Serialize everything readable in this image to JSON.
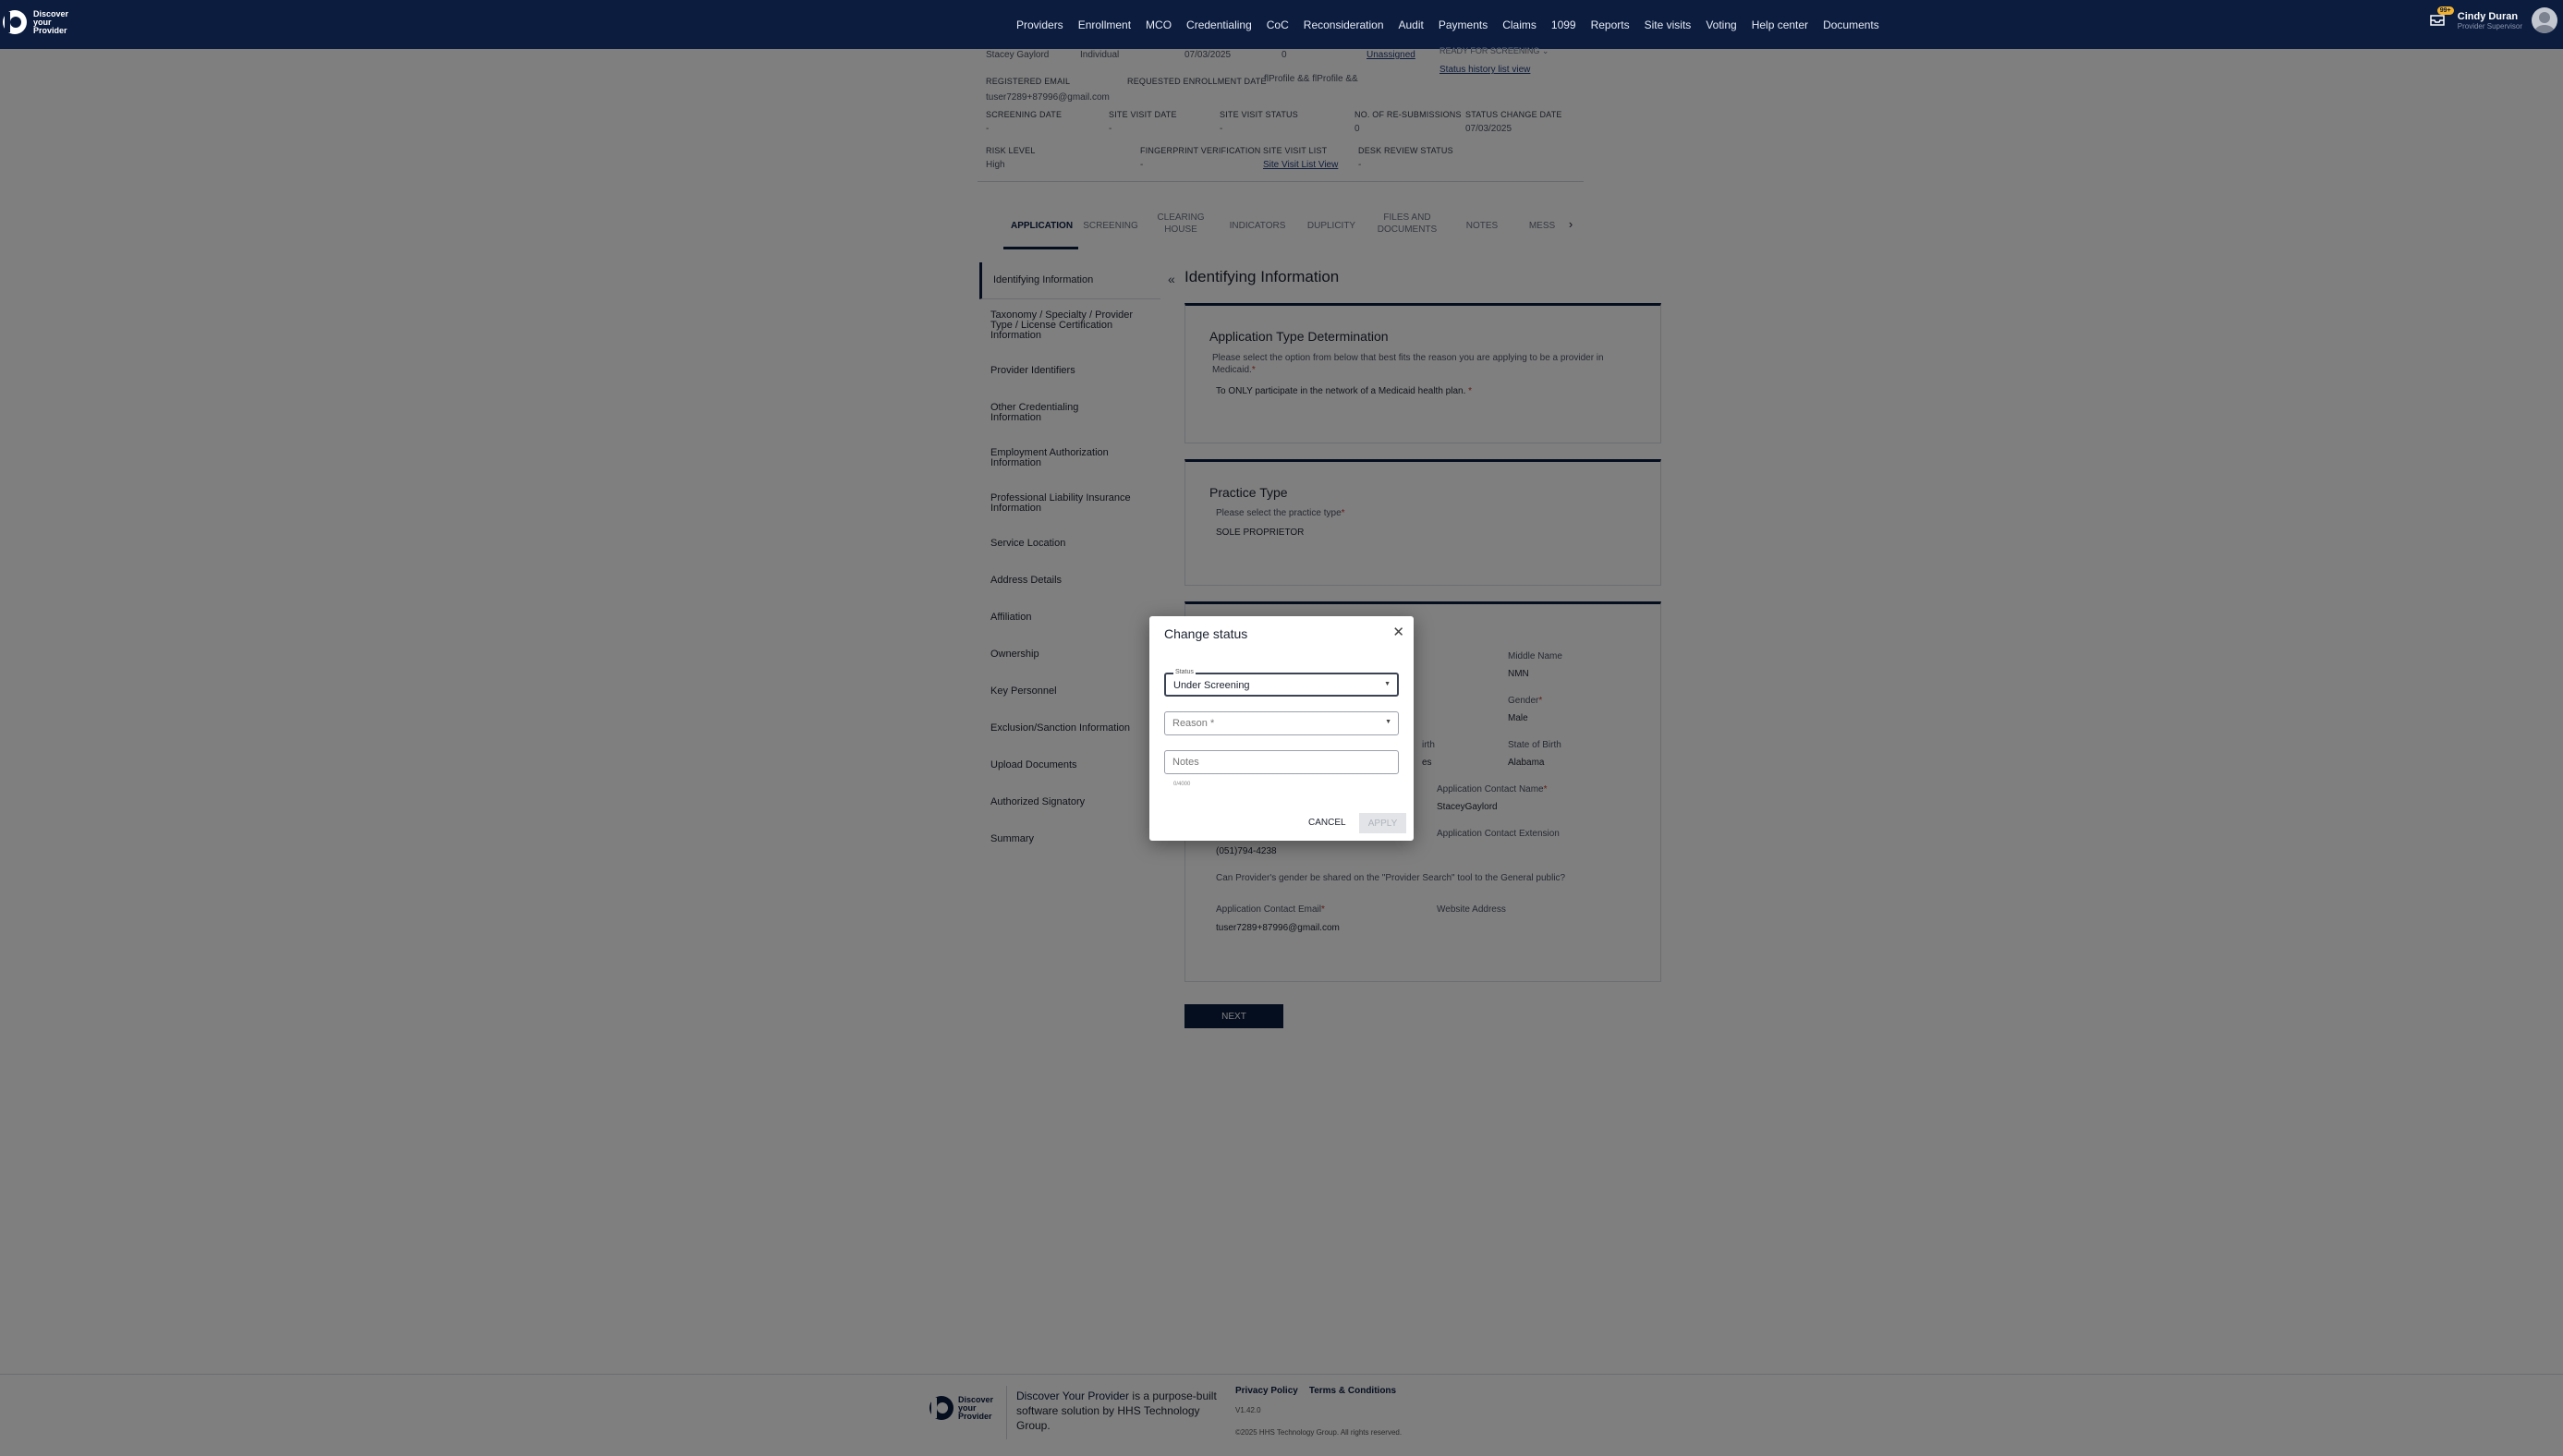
{
  "brand": {
    "line1": "Discover",
    "line2": "your",
    "line3": "Provider"
  },
  "nav": [
    "Providers",
    "Enrollment",
    "MCO",
    "Credentialing",
    "CoC",
    "Reconsideration",
    "Audit",
    "Payments",
    "Claims",
    "1099",
    "Reports",
    "Site visits",
    "Voting",
    "Help center",
    "Documents"
  ],
  "user": {
    "name": "Cindy Duran",
    "role": "Provider Supervisor",
    "notifications": "99+"
  },
  "info": {
    "row0": {
      "name": "Stacey Gaylord",
      "type": "Individual",
      "date": "07/03/2025",
      "count": "0",
      "assignee": "Unassigned",
      "status": "READY FOR SCREENING",
      "status_link": "Status history list view"
    },
    "registered_email_label": "REGISTERED EMAIL",
    "registered_email": "tuser7289+87996@gmail.com",
    "requested_enrollment_label": "REQUESTED ENROLLMENT DATE",
    "requested_enrollment": "flProfile && flProfile &&",
    "screening_date_label": "SCREENING DATE",
    "screening_date": "-",
    "site_visit_date_label": "SITE VISIT DATE",
    "site_visit_date": "-",
    "site_visit_status_label": "SITE VISIT STATUS",
    "site_visit_status": "-",
    "resubmissions_label": "NO. OF RE-SUBMISSIONS",
    "resubmissions": "0",
    "status_change_label": "STATUS CHANGE DATE",
    "status_change": "07/03/2025",
    "risk_level_label": "RISK LEVEL",
    "risk_level": "High",
    "fingerprint_label": "FINGERPRINT VERIFICATION",
    "fingerprint": "-",
    "site_visit_list_label": "SITE VISIT LIST",
    "site_visit_list": "Site Visit List View",
    "desk_review_label": "DESK REVIEW STATUS",
    "desk_review": "-"
  },
  "tabs": [
    "APPLICATION",
    "SCREENING",
    "CLEARING HOUSE",
    "INDICATORS",
    "DUPLICITY",
    "FILES AND DOCUMENTS",
    "NOTES",
    "MESS"
  ],
  "side_menu": [
    "Identifying Information",
    "Taxonomy / Specialty / Provider Type / License Certification Information",
    "Provider Identifiers",
    "Other Credentialing Information",
    "Employment Authorization Information",
    "Professional Liability Insurance Information",
    "Service Location",
    "Address Details",
    "Affiliation",
    "Ownership",
    "Key Personnel",
    "Exclusion/Sanction Information",
    "Upload Documents",
    "Authorized Signatory",
    "Summary"
  ],
  "page_title": "Identifying Information",
  "app_type": {
    "title": "Application Type Determination",
    "question": "Please select the option from below that best fits the reason you are applying to be a provider in Medicaid.",
    "answer": "To ONLY participate in the network of a Medicaid health plan."
  },
  "practice": {
    "title": "Practice Type",
    "question": "Please select the practice type",
    "answer": "SOLE PROPRIETOR"
  },
  "identity": {
    "middle_name_label": "Middle Name",
    "middle_name": "NMN",
    "gender_label": "Gender",
    "gender": "Male",
    "dob_fragment": "irth",
    "country_fragment": "es",
    "state_of_birth_label": "State of Birth",
    "state_of_birth": "Alabama",
    "contact_name_label": "Application Contact Name",
    "contact_name": "StaceyGaylord",
    "contact_ext_label": "Application Contact Extension",
    "phone": "(051)794-4238",
    "gender_share_question": "Can Provider's gender be shared on the \"Provider Search\" tool to the General public?",
    "contact_email_label": "Application Contact Email",
    "contact_email": "tuser7289+87996@gmail.com",
    "website_label": "Website Address"
  },
  "next_label": "NEXT",
  "modal": {
    "title": "Change status",
    "status_label": "Status",
    "status_value": "Under Screening",
    "reason_placeholder": "Reason *",
    "notes_placeholder": "Notes",
    "counter": "0/4000",
    "cancel": "CANCEL",
    "apply": "APPLY"
  },
  "footer": {
    "brand_name": "Discover Your Provider",
    "tagline": " is a purpose-built software solution by HHS Technology Group.",
    "privacy": "Privacy Policy",
    "terms": "Terms & Conditions",
    "version": "V1.42.0",
    "copyright": "©2025 HHS Technology Group. All rights reserved."
  }
}
